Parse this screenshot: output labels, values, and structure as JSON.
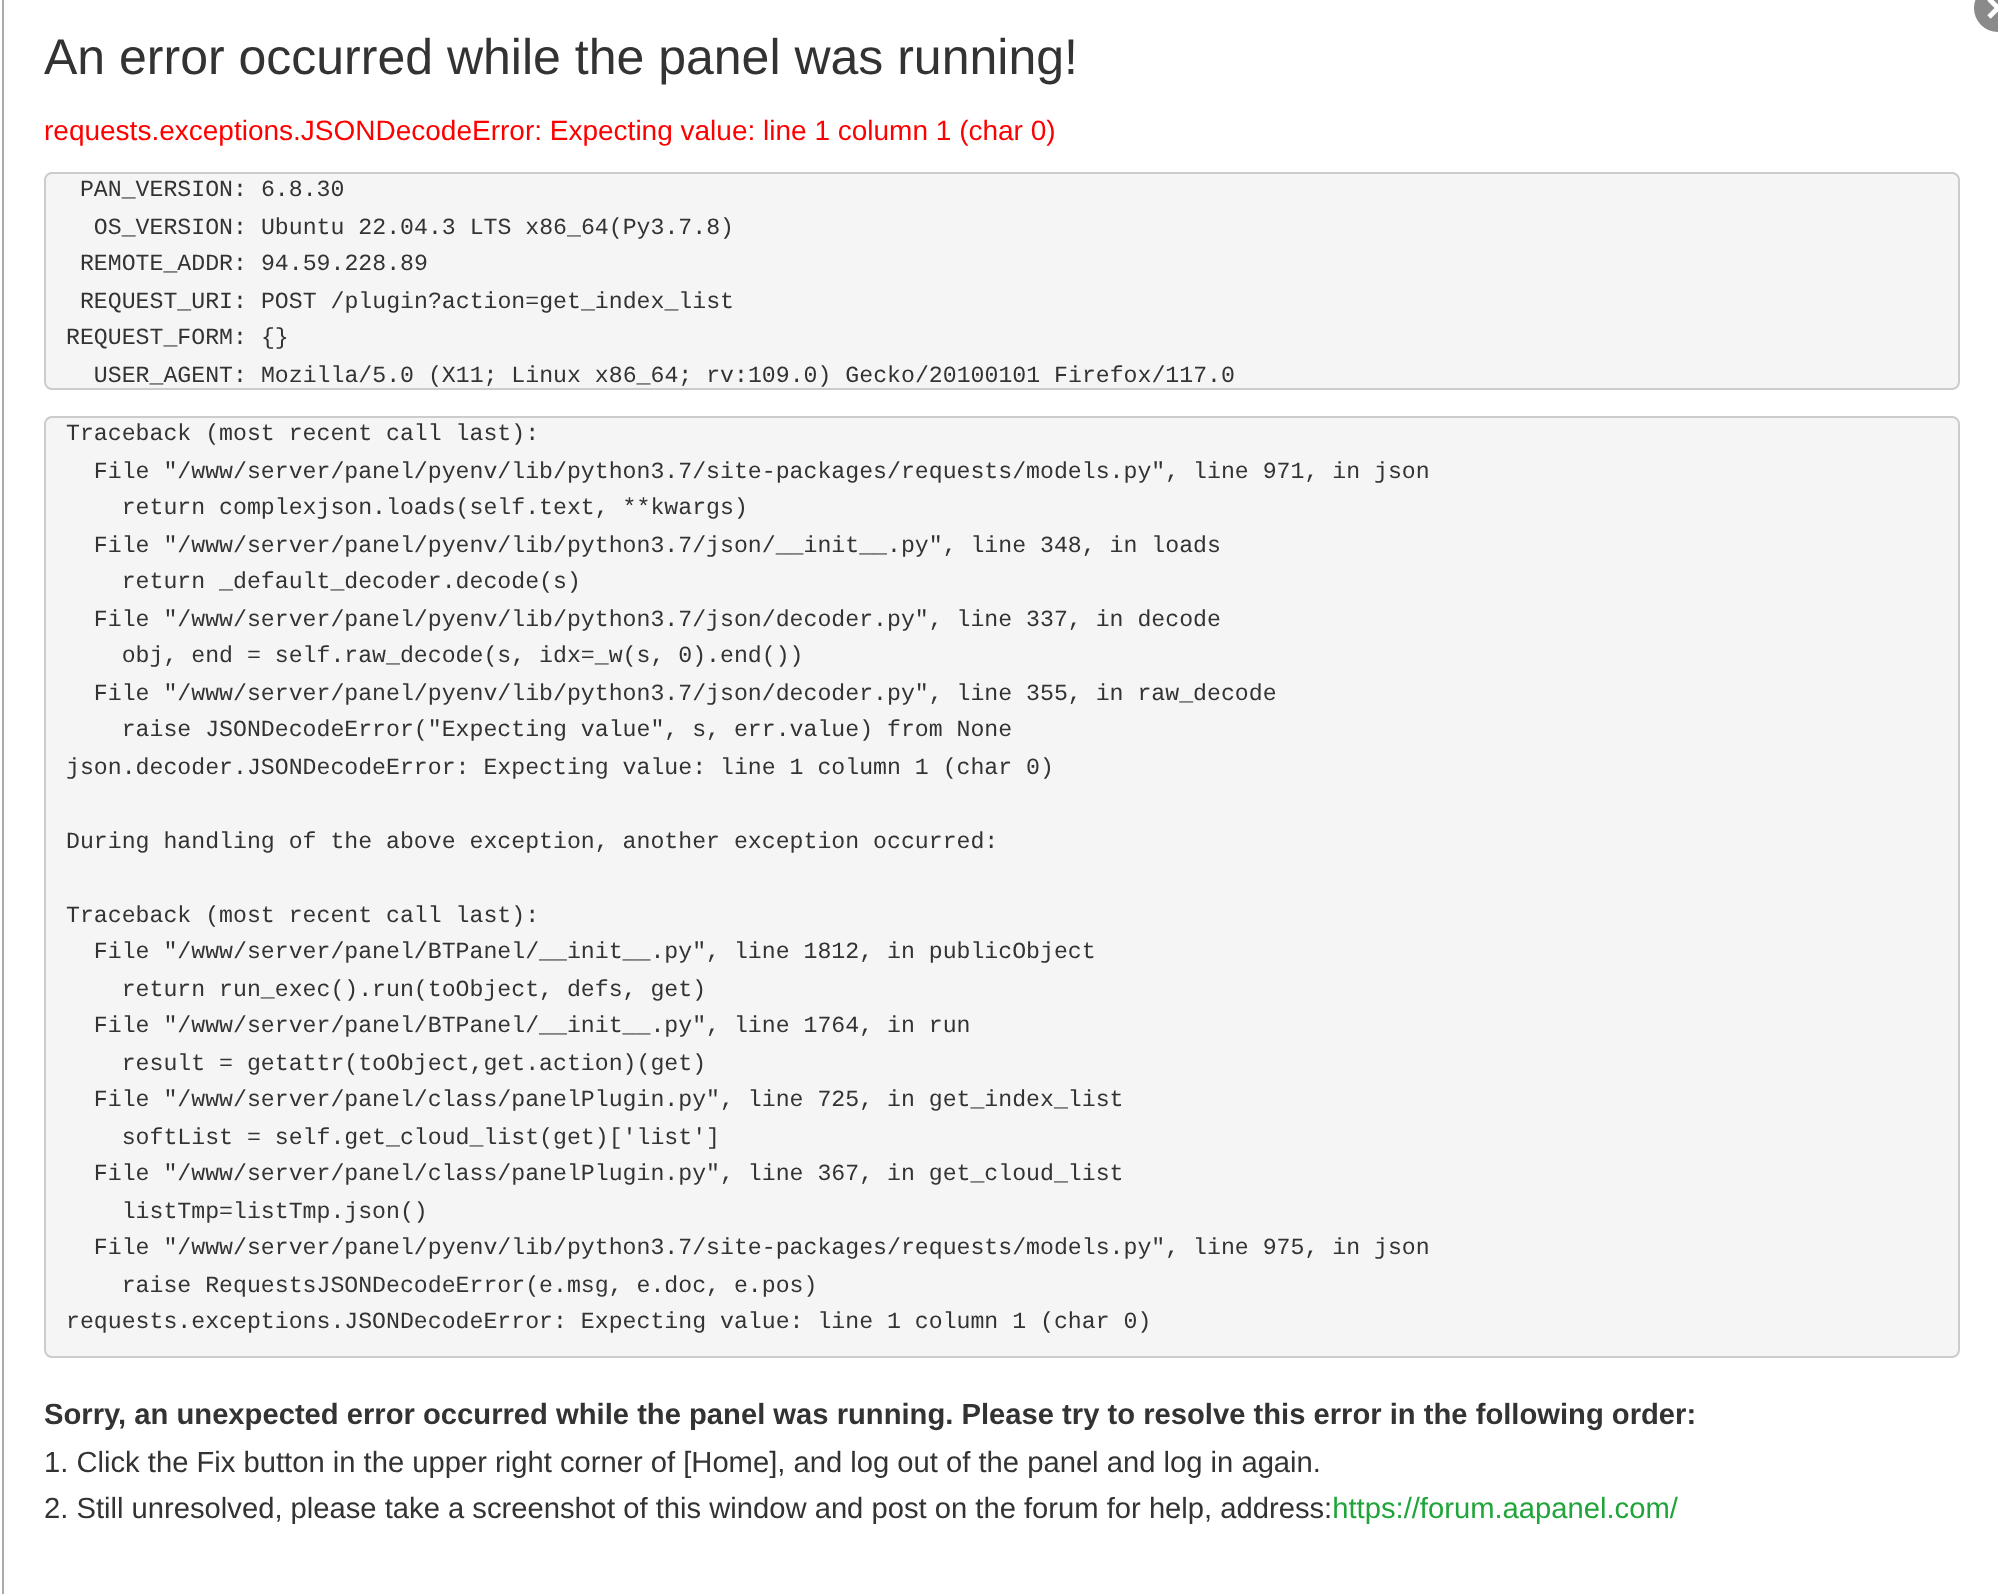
{
  "dialog": {
    "title": "An error occurred while the panel was running!",
    "error": "requests.exceptions.JSONDecodeError: Expecting value: line 1 column 1 (char 0)"
  },
  "environment": [
    {
      "key": "PAN_VERSION:",
      "value": "6.8.30"
    },
    {
      "key": "OS_VERSION:",
      "value": "Ubuntu 22.04.3 LTS x86_64(Py3.7.8)"
    },
    {
      "key": "REMOTE_ADDR:",
      "value": "94.59.228.89"
    },
    {
      "key": "REQUEST_URI:",
      "value": "POST /plugin?action=get_index_list"
    },
    {
      "key": "REQUEST_FORM:",
      "value": "{}"
    },
    {
      "key": "USER_AGENT:",
      "value": "Mozilla/5.0 (X11; Linux x86_64; rv:109.0) Gecko/20100101 Firefox/117.0"
    }
  ],
  "traceback": [
    [
      "Traceback (most recent call last):",
      "  File \"/www/server/panel/pyenv/lib/python3.7/site-packages/requests/models.py\", line 971, in json",
      "    return complexjson.loads(self.text, **kwargs)",
      "  File \"/www/server/panel/pyenv/lib/python3.7/json/__init__.py\", line 348, in loads",
      "    return _default_decoder.decode(s)",
      "  File \"/www/server/panel/pyenv/lib/python3.7/json/decoder.py\", line 337, in decode",
      "    obj, end = self.raw_decode(s, idx=_w(s, 0).end())",
      "  File \"/www/server/panel/pyenv/lib/python3.7/json/decoder.py\", line 355, in raw_decode",
      "    raise JSONDecodeError(\"Expecting value\", s, err.value) from None",
      "json.decoder.JSONDecodeError: Expecting value: line 1 column 1 (char 0)"
    ],
    [
      "During handling of the above exception, another exception occurred:"
    ],
    [
      "Traceback (most recent call last):",
      "  File \"/www/server/panel/BTPanel/__init__.py\", line 1812, in publicObject",
      "    return run_exec().run(toObject, defs, get)",
      "  File \"/www/server/panel/BTPanel/__init__.py\", line 1764, in run",
      "    result = getattr(toObject,get.action)(get)",
      "  File \"/www/server/panel/class/panelPlugin.py\", line 725, in get_index_list",
      "    softList = self.get_cloud_list(get)['list']",
      "  File \"/www/server/panel/class/panelPlugin.py\", line 367, in get_cloud_list",
      "    listTmp=listTmp.json()",
      "  File \"/www/server/panel/pyenv/lib/python3.7/site-packages/requests/models.py\", line 975, in json",
      "    raise RequestsJSONDecodeError(e.msg, e.doc, e.pos)",
      "requests.exceptions.JSONDecodeError: Expecting value: line 1 column 1 (char 0)"
    ]
  ],
  "help": {
    "heading": "Sorry, an unexpected error occurred while the panel was running. Please try to resolve this error in the following order:",
    "steps": [
      {
        "text": "1. Click the Fix button in the upper right corner of [Home], and log out of the panel and log in again."
      },
      {
        "text": "2. Still unresolved, please take a screenshot of this window and post on the forum for help, address:",
        "link": "https://forum.aapanel.com/"
      }
    ]
  }
}
